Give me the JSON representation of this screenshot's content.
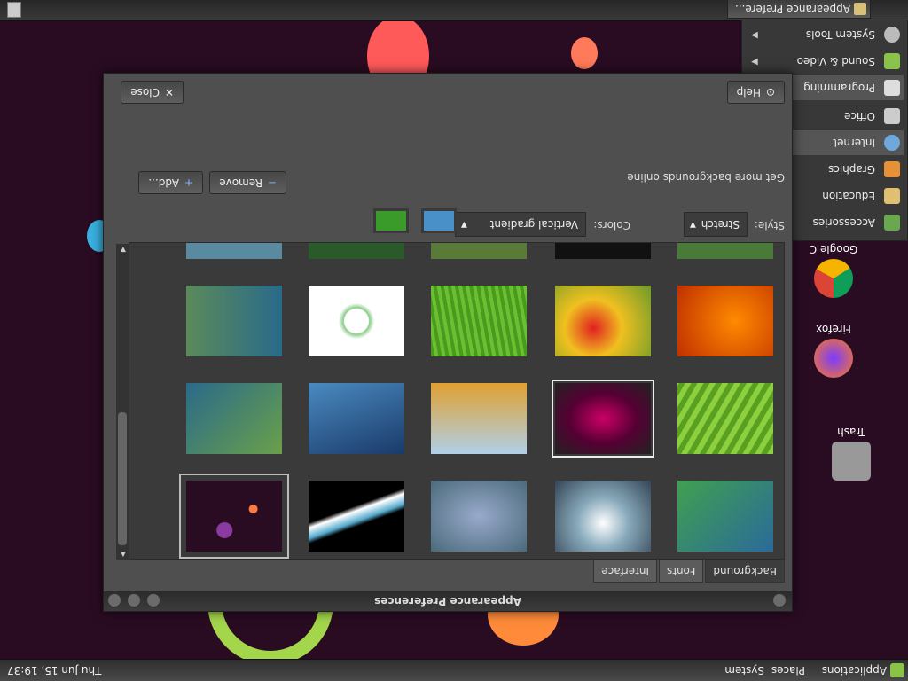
{
  "top_panel": {
    "menus": [
      "Applications",
      "Places",
      "System"
    ],
    "clock": "Thu Jun 15, 19:37"
  },
  "bottom_panel": {
    "task_title": "Appearance Prefere..."
  },
  "desktop_icons": [
    {
      "label": "Trash"
    },
    {
      "label": "Firefox"
    },
    {
      "label": "Google C"
    }
  ],
  "app_menu": {
    "items": [
      {
        "label": "Accessories",
        "icon": "accessories-icon",
        "color": "#6aa84f"
      },
      {
        "label": "Education",
        "icon": "education-icon",
        "color": "#e0c070"
      },
      {
        "label": "Graphics",
        "icon": "graphics-icon",
        "color": "#e69138"
      },
      {
        "label": "Internet",
        "icon": "globe-icon",
        "color": "#6fa8dc"
      },
      {
        "label": "Office",
        "icon": "office-icon",
        "color": "#cccccc"
      },
      {
        "label": "Programming",
        "icon": "programming-icon",
        "color": "#dddddd"
      },
      {
        "label": "Sound & Video",
        "icon": "sound-video-icon",
        "color": "#8bc34a"
      },
      {
        "label": "System Tools",
        "icon": "system-tools-icon",
        "color": "#bbbbbb"
      }
    ]
  },
  "window": {
    "title": "Appearance Preferences",
    "tabs": [
      "Background",
      "Fonts",
      "Interface"
    ],
    "active_tab": "Background",
    "style_label": "Style:",
    "style_value": "Stretch",
    "colors_label": "Colors:",
    "colors_value": "Vertical gradient",
    "color1": "#4a90c8",
    "color2": "#3a9a2a",
    "online_link": "Get more backgrounds online",
    "remove_label": "Remove",
    "add_label": "Add...",
    "help_label": "Help",
    "close_label": "Close"
  }
}
